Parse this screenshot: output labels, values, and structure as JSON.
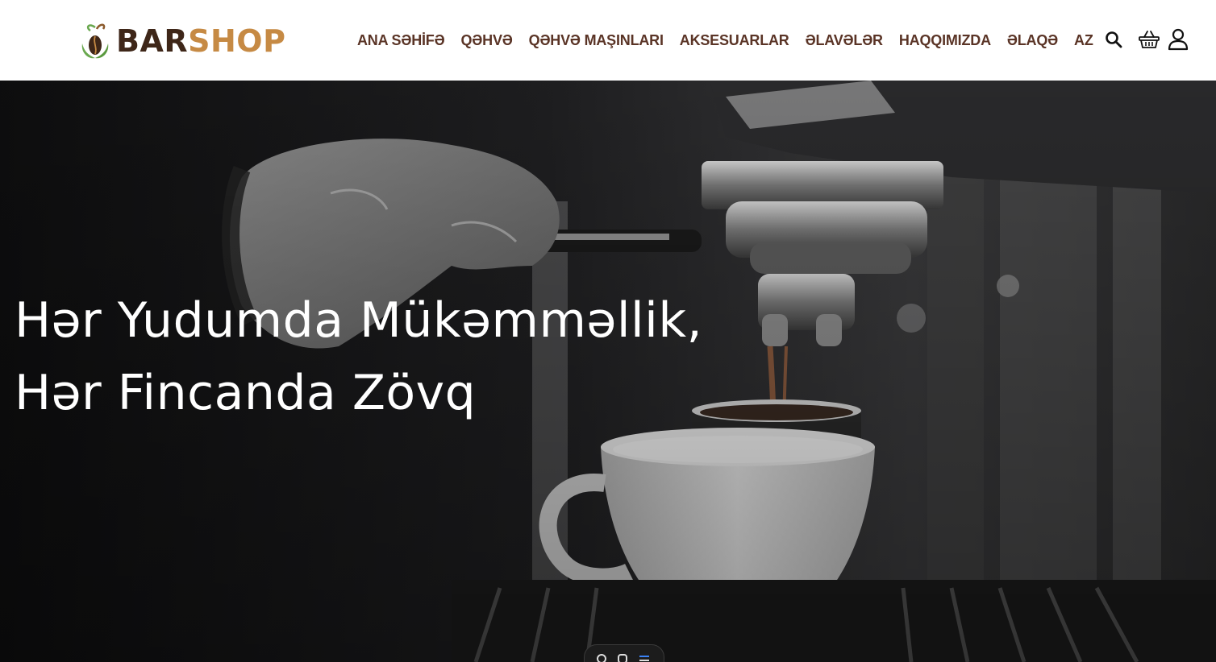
{
  "brand": {
    "name_part1": "BAR",
    "name_part2": "SHOP",
    "colors": {
      "dark": "#3e2618",
      "accent": "#c68a44",
      "leaf": "#6aa84f"
    }
  },
  "nav": {
    "items": [
      {
        "label": "ANA SƏHİFƏ",
        "name": "nav-home"
      },
      {
        "label": "QƏHVƏ",
        "name": "nav-coffee"
      },
      {
        "label": "QƏHVƏ MAŞINLARI",
        "name": "nav-coffee-machines"
      },
      {
        "label": "AKSESUARLAR",
        "name": "nav-accessories"
      },
      {
        "label": "ƏLAVƏLƏR",
        "name": "nav-extras"
      },
      {
        "label": "HAQQIMIZDA",
        "name": "nav-about"
      },
      {
        "label": "ƏLAQƏ",
        "name": "nav-contact"
      }
    ],
    "language": "AZ",
    "color": "#5a3426",
    "icons": [
      "search-icon",
      "basket-icon",
      "user-icon"
    ]
  },
  "hero": {
    "line1": "Hər Yudumda Mükəmməllik,",
    "line2": "Hər Fincanda Zövq",
    "text_color": "#ffffff"
  }
}
